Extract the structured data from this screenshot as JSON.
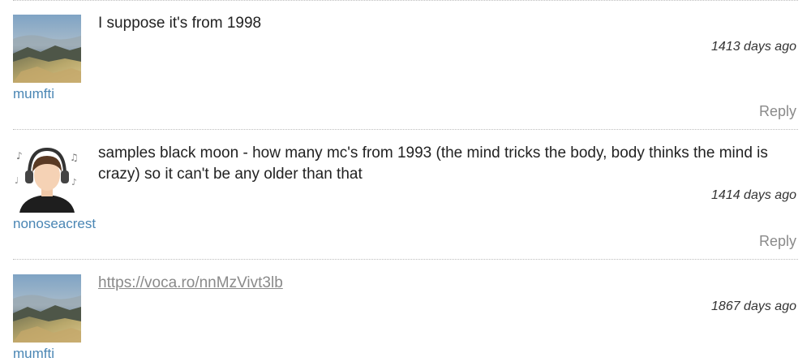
{
  "comments": [
    {
      "avatar": "landscape-avatar",
      "username": "mumfti",
      "text": "I suppose it's from 1998",
      "time": "1413 days ago",
      "reply": "Reply"
    },
    {
      "avatar": "headphones-person-avatar",
      "username": "nonoseacrest",
      "text": "samples black moon - how many mc's from 1993 (the mind tricks the body, body thinks the mind is crazy) so it can't be any older than that",
      "time": "1414 days ago",
      "reply": "Reply"
    },
    {
      "avatar": "landscape-avatar",
      "username": "mumfti",
      "link": "https://voca.ro/nnMzVivt3lb",
      "time": "1867 days ago"
    }
  ]
}
